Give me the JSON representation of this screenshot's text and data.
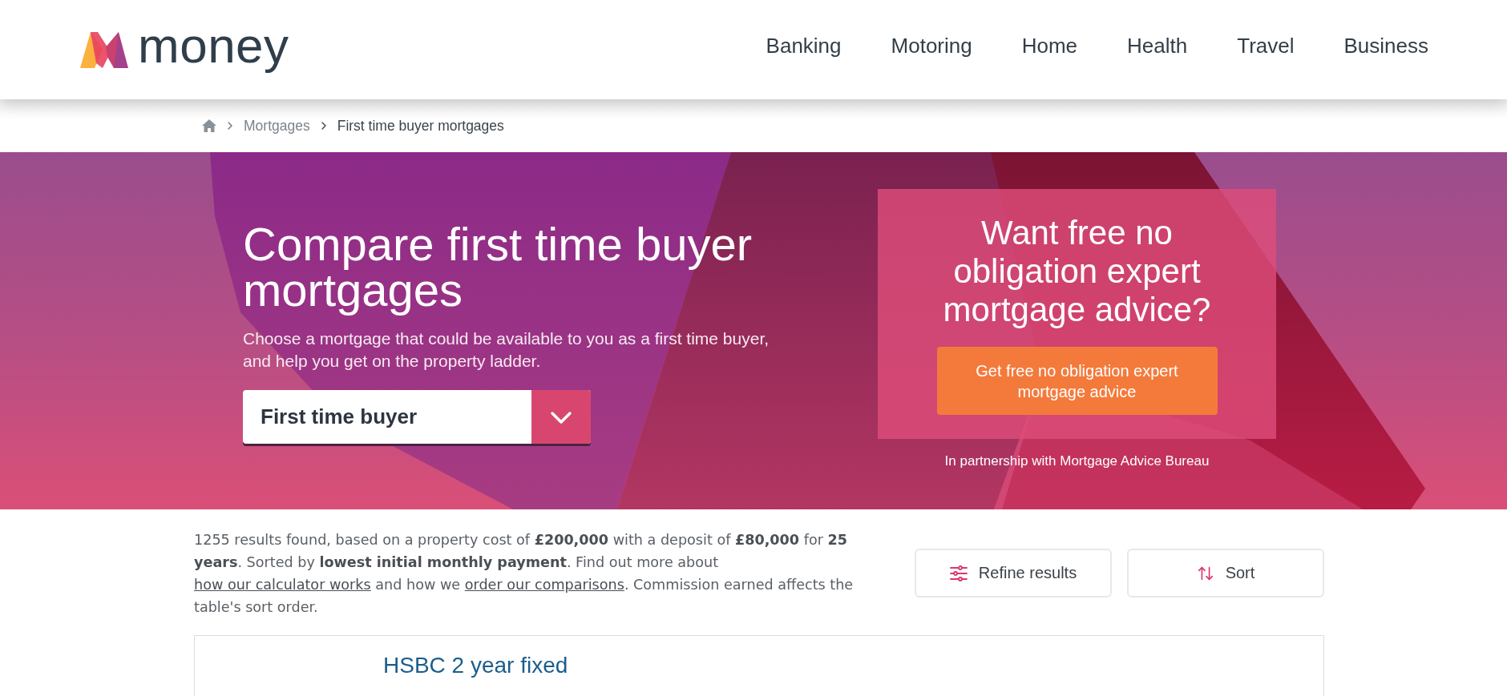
{
  "header": {
    "logo": {
      "text": "money"
    },
    "nav": [
      "Banking",
      "Motoring",
      "Home",
      "Health",
      "Travel",
      "Business"
    ]
  },
  "breadcrumb": [
    {
      "label": "Mortgages",
      "current": false
    },
    {
      "label": "First time buyer mortgages",
      "current": true
    }
  ],
  "hero": {
    "title": "Compare first time buyer mortgages",
    "subtitle": "Choose a mortgage that could be available to you as a first time buyer, and help you get on the property ladder.",
    "mortgage_type": {
      "value": "First time buyer"
    }
  },
  "advice": {
    "title": "Want free no obligation expert mortgage advice?",
    "button": "Get free no obligation expert mortgage advice",
    "note": "In partnership with Mortgage Advice Bureau"
  },
  "results": {
    "summary": [
      {
        "kind": "text",
        "text": "1255 results found, based on a property cost of **£200,000** with a deposit of **£80,000** for **25 years**. Sorted by **lowest initial monthly payment**. Find out more about "
      },
      {
        "kind": "link",
        "text": "how our calculator works"
      },
      {
        "kind": "text",
        "text": " and how we "
      },
      {
        "kind": "link",
        "text": "order our comparisons"
      },
      {
        "kind": "text",
        "text": ". Commission earned affects the table's sort order."
      }
    ],
    "buttons": [
      {
        "kind": "refine",
        "label": "Refine results"
      },
      {
        "kind": "sort",
        "label": "Sort"
      }
    ]
  },
  "products": [
    {
      "title": "HSBC 2 year fixed"
    }
  ]
}
